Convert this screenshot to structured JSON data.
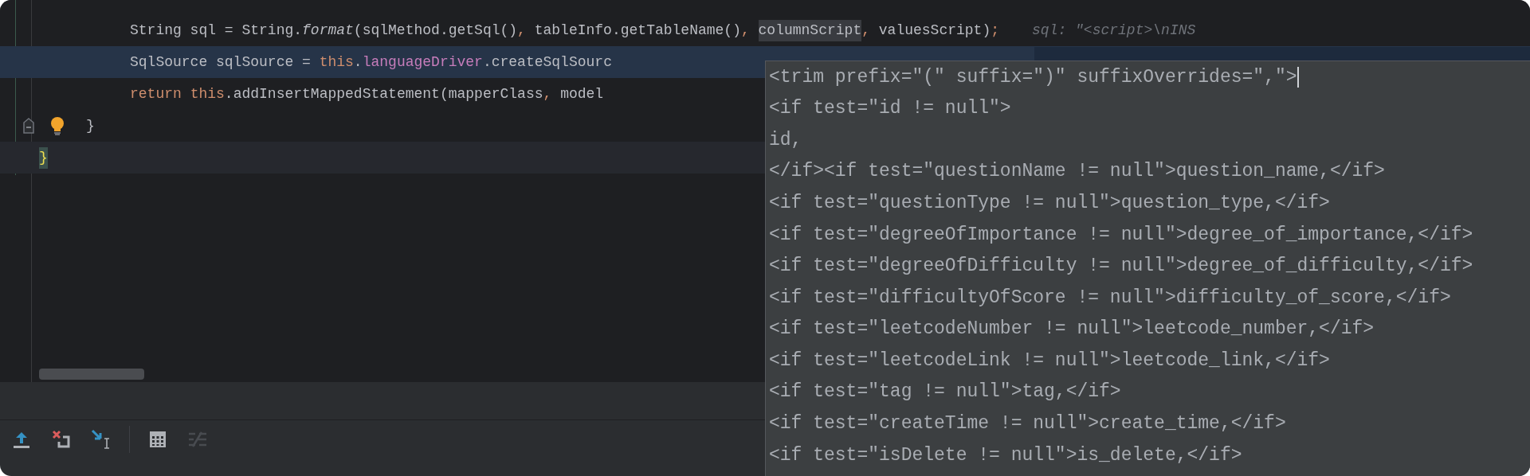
{
  "editor": {
    "lines": [
      {
        "kind": "plain",
        "tokens": [
          {
            "kind": "plain",
            "text": "String sql = String."
          },
          {
            "kind": "italic",
            "text": "format"
          },
          {
            "kind": "plain",
            "text": "(sqlMethod.getSql()"
          },
          {
            "kind": "punct",
            "text": ", "
          },
          {
            "kind": "plain",
            "text": "tableInfo.getTableName()"
          },
          {
            "kind": "punct",
            "text": ", "
          },
          {
            "kind": "highlight",
            "text": "columnScript"
          },
          {
            "kind": "punct",
            "text": ", "
          },
          {
            "kind": "plain",
            "text": "valuesScript)"
          },
          {
            "kind": "punct",
            "text": ";"
          }
        ],
        "hint": "sql: \"<script>\\nINS"
      },
      {
        "kind": "selected",
        "tokens": [
          {
            "kind": "plain",
            "text": "SqlSource sqlSource = "
          },
          {
            "kind": "keyword",
            "text": "this"
          },
          {
            "kind": "plain",
            "text": "."
          },
          {
            "kind": "field",
            "text": "languageDriver"
          },
          {
            "kind": "plain",
            "text": ".createSqlSourc"
          }
        ]
      },
      {
        "kind": "plain",
        "tokens": [
          {
            "kind": "keyword",
            "text": "return "
          },
          {
            "kind": "keyword",
            "text": "this"
          },
          {
            "kind": "plain",
            "text": ".addInsertMappedStatement(mapperClass"
          },
          {
            "kind": "punct",
            "text": ", "
          },
          {
            "kind": "plain",
            "text": "model"
          }
        ]
      },
      {
        "kind": "plain",
        "fold": true,
        "bulb": true,
        "tokens": [
          {
            "kind": "plain",
            "text": "}"
          }
        ]
      },
      {
        "kind": "current",
        "tokens": [
          {
            "kind": "matched",
            "text": "}"
          }
        ]
      }
    ]
  },
  "popup": {
    "lines": [
      "<trim prefix=\"(\" suffix=\")\" suffixOverrides=\",\">",
      "<if test=\"id != null\">",
      "id,",
      "</if><if test=\"questionName != null\">question_name,</if>",
      "<if test=\"questionType != null\">question_type,</if>",
      "<if test=\"degreeOfImportance != null\">degree_of_importance,</if>",
      "<if test=\"degreeOfDifficulty != null\">degree_of_difficulty,</if>",
      "<if test=\"difficultyOfScore != null\">difficulty_of_score,</if>",
      "<if test=\"leetcodeNumber != null\">leetcode_number,</if>",
      "<if test=\"leetcodeLink != null\">leetcode_link,</if>",
      "<if test=\"tag != null\">tag,</if>",
      "<if test=\"createTime != null\">create_time,</if>",
      "<if test=\"isDelete != null\">is_delete,</if>"
    ]
  },
  "toolbar": {
    "buttons": [
      {
        "disabled": false
      },
      {
        "disabled": false
      },
      {
        "disabled": false
      },
      {
        "disabled": false
      },
      {
        "disabled": true
      }
    ]
  }
}
